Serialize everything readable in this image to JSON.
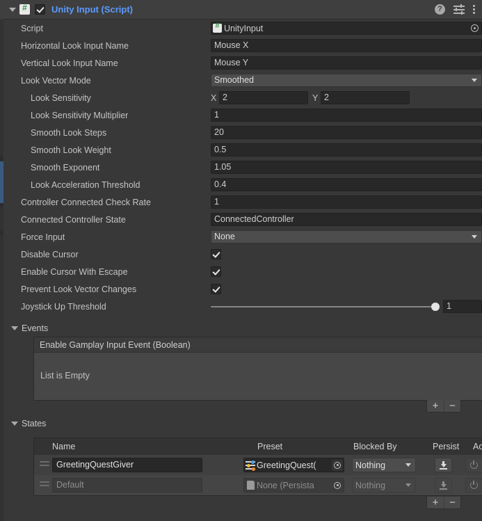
{
  "header": {
    "title": "Unity Input (Script)",
    "enabled": true,
    "icons": {
      "help": "?",
      "preset": "preset-icon",
      "menu": "kebab-menu-icon"
    }
  },
  "properties": [
    {
      "label": "Script",
      "type": "object",
      "value": "UnityInput",
      "indent": 0
    },
    {
      "label": "Horizontal Look Input Name",
      "type": "text",
      "value": "Mouse X",
      "indent": 0
    },
    {
      "label": "Vertical Look Input Name",
      "type": "text",
      "value": "Mouse Y",
      "indent": 0
    },
    {
      "label": "Look Vector Mode",
      "type": "dropdown",
      "value": "Smoothed",
      "indent": 0
    },
    {
      "label": "Look Sensitivity",
      "type": "vector2",
      "x_label": "X",
      "x": "2",
      "y_label": "Y",
      "y": "2",
      "indent": 1
    },
    {
      "label": "Look Sensitivity Multiplier",
      "type": "text",
      "value": "1",
      "indent": 1
    },
    {
      "label": "Smooth Look Steps",
      "type": "text",
      "value": "20",
      "indent": 1
    },
    {
      "label": "Smooth Look Weight",
      "type": "text",
      "value": "0.5",
      "indent": 1
    },
    {
      "label": "Smooth Exponent",
      "type": "text",
      "value": "1.05",
      "indent": 1
    },
    {
      "label": "Look Acceleration Threshold",
      "type": "text",
      "value": "0.4",
      "indent": 1
    },
    {
      "label": "Controller Connected Check Rate",
      "type": "text",
      "value": "1",
      "indent": 0
    },
    {
      "label": "Connected Controller State",
      "type": "text",
      "value": "ConnectedController",
      "indent": 0
    },
    {
      "label": "Force Input",
      "type": "dropdown",
      "value": "None",
      "indent": 0
    },
    {
      "label": "Disable Cursor",
      "type": "checkbox",
      "checked": true,
      "indent": 0
    },
    {
      "label": "Enable Cursor With Escape",
      "type": "checkbox",
      "checked": true,
      "indent": 0
    },
    {
      "label": "Prevent Look Vector Changes",
      "type": "checkbox",
      "checked": true,
      "indent": 0
    },
    {
      "label": "Joystick Up Threshold",
      "type": "slider",
      "value": "1",
      "fill": 100,
      "indent": 0
    }
  ],
  "events": {
    "section_title": "Events",
    "list_title": "Enable Gamplay Input Event (Boolean)",
    "empty_text": "List is Empty",
    "add_label": "+",
    "remove_label": "−"
  },
  "states": {
    "section_title": "States",
    "columns": [
      "Name",
      "Preset",
      "Blocked By",
      "Persist",
      "Activate"
    ],
    "rows": [
      {
        "name": "GreetingQuestGiver",
        "preset": "GreetingQuest(",
        "preset_icon": "preset-icon",
        "blocked_by": "Nothing",
        "persist": "download-icon",
        "activate": "power-icon",
        "dimmed": false
      },
      {
        "name": "Default",
        "preset": "None (Persista",
        "preset_icon": "file-icon",
        "blocked_by": "Nothing",
        "persist": "download-icon",
        "activate": "power-icon",
        "dimmed": true
      }
    ],
    "add_label": "+",
    "remove_label": "−"
  },
  "colors": {
    "panel_bg": "#383838",
    "header_bg": "#3f3f3f",
    "title_blue": "#5b9bff",
    "field_bg": "#282828",
    "dropdown_bg": "#4d4d4d",
    "text": "#c4c4c4"
  }
}
